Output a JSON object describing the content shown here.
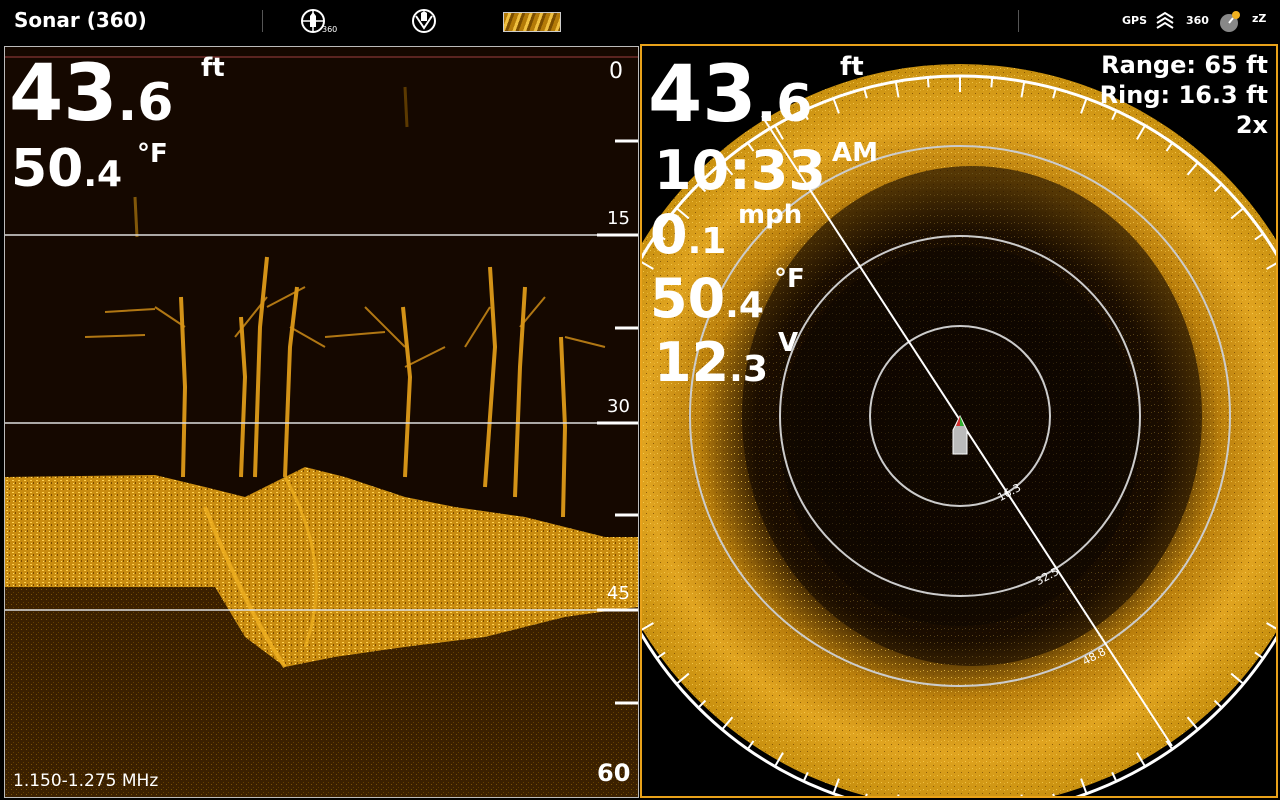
{
  "header": {
    "title": "Sonar (360)",
    "mode_icons": [
      "360-imaging-icon",
      "down-imaging-icon",
      "palette-swatch"
    ],
    "status_icons": [
      "GPS",
      "signal-icon",
      "360",
      "alarm-icon",
      "sleep-icon"
    ],
    "icon_360_label": "360",
    "gps_label": "GPS",
    "sleep_label": "zZ"
  },
  "left_panel": {
    "depth_int": "43",
    "depth_dec": ".6",
    "depth_unit": "ft",
    "temp_int": "50",
    "temp_dec": ".4",
    "temp_unit": "°F",
    "scale_top": "0",
    "scale_labels": [
      "15",
      "30",
      "45"
    ],
    "scale_bottom": "60",
    "frequency": "1.150-1.275 MHz"
  },
  "right_panel": {
    "depth_int": "43",
    "depth_dec": ".6",
    "depth_unit": "ft",
    "time_main": "10:33",
    "time_ampm": "AM",
    "speed_int": "0",
    "speed_dec": ".1",
    "speed_unit": "mph",
    "temp_int": "50",
    "temp_dec": ".4",
    "temp_unit": "°F",
    "volt_int": "12",
    "volt_dec": ".3",
    "volt_unit": "V",
    "range": "Range: 65 ft",
    "ring": "Ring: 16.3 ft",
    "zoom": "2x",
    "ring_labels": [
      "16.3",
      "32.5",
      "48.8"
    ]
  },
  "colors": {
    "sonar_gold": "#f0b020",
    "background": "#150800",
    "active_border": "#e8a21a"
  }
}
